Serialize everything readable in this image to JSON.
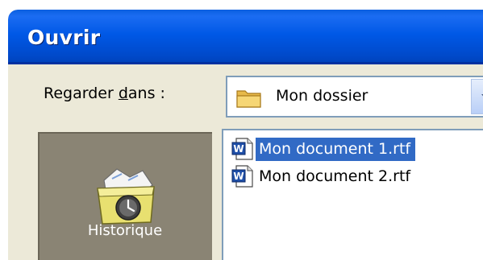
{
  "dialog": {
    "title": "Ouvrir"
  },
  "look_in": {
    "label_prefix": "Regarder ",
    "label_underlined": "d",
    "label_suffix": "ans :",
    "selected": "Mon dossier",
    "icon": "folder-icon"
  },
  "places_bar": {
    "items": [
      {
        "label": "Historique",
        "icon": "history-icon"
      }
    ]
  },
  "files": [
    {
      "name": "Mon document 1.rtf",
      "icon": "word-document-icon",
      "selected": true
    },
    {
      "name": "Mon document 2.rtf",
      "icon": "word-document-icon",
      "selected": false
    }
  ],
  "colors": {
    "titlebar": "#0058e6",
    "dialog_bg": "#ece9d8",
    "places_bg": "#8a8474",
    "selection": "#316ac5"
  }
}
